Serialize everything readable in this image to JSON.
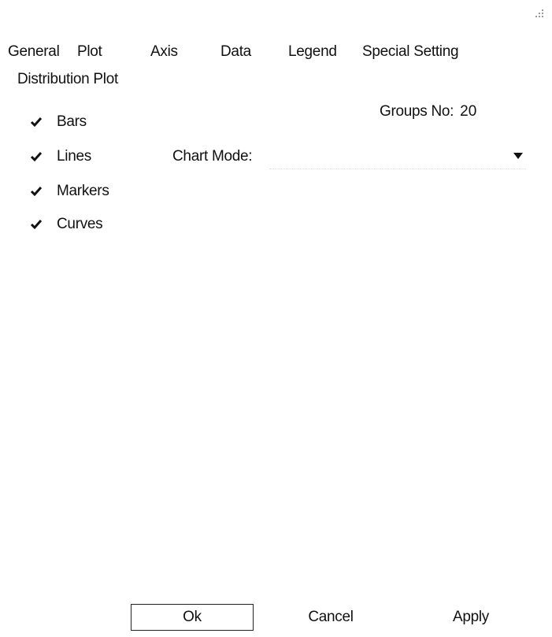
{
  "window": {
    "corner_icon": "resize-grip-icon"
  },
  "tabs": [
    {
      "label": "General"
    },
    {
      "label": "Plot"
    },
    {
      "label": "Axis"
    },
    {
      "label": "Data"
    },
    {
      "label": "Legend"
    },
    {
      "label": "Special Setting"
    }
  ],
  "section": {
    "title": "Distribution Plot"
  },
  "options": [
    {
      "label": "Bars",
      "checked": true
    },
    {
      "label": "Lines",
      "checked": true
    },
    {
      "label": "Markers",
      "checked": true
    },
    {
      "label": "Curves",
      "checked": true
    }
  ],
  "groups": {
    "label": "Groups No:",
    "value": "20"
  },
  "chart_mode": {
    "label": "Chart Mode:",
    "value": ""
  },
  "buttons": {
    "ok": "Ok",
    "cancel": "Cancel",
    "apply": "Apply"
  },
  "colors": {
    "text": "#111111",
    "background": "#ffffff",
    "border": "#222222"
  }
}
